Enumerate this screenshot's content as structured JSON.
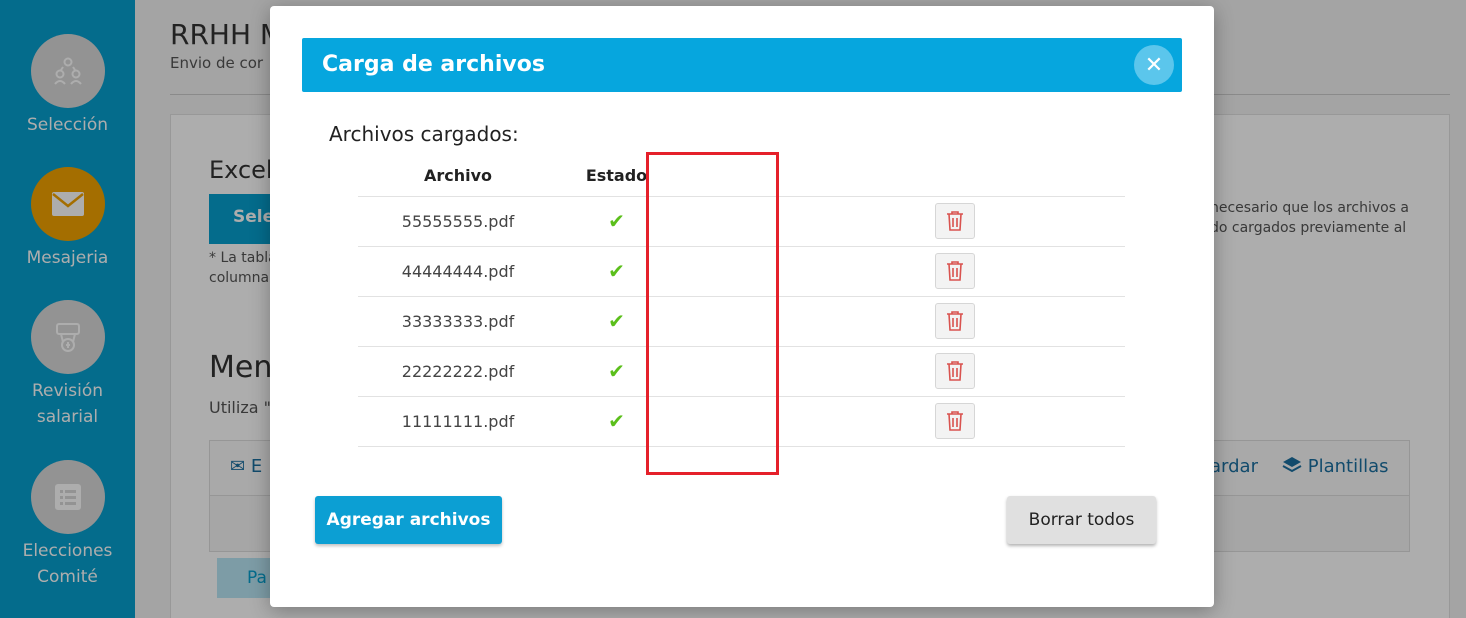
{
  "sidebar": {
    "items": [
      {
        "label": "Selección",
        "icon": "people-network-icon"
      },
      {
        "label": "Mesajeria",
        "icon": "envelope-icon"
      },
      {
        "label_line1": "Revisión",
        "label_line2": "salarial",
        "icon": "salary-review-icon"
      },
      {
        "label_line1": "Elecciones",
        "label_line2": "Comité",
        "icon": "ballot-list-icon"
      }
    ],
    "active_color": "#f2a200",
    "bg_color": "#06a0cf"
  },
  "background": {
    "title": "RRHH M",
    "subtitle": "Envio de cor",
    "excel_heading": "Excel",
    "select_button": "Sele",
    "note_line1": "* La tabla",
    "note_line2": "columna",
    "right_note_line1": "necesario que los archivos a",
    "right_note_line2": "do cargados previamente al",
    "men_heading": "Men",
    "utiliza_text": "Utiliza \"",
    "toolbar_e": "E",
    "toolbar_guardar": "ardar",
    "toolbar_plantillas": "Plantillas",
    "pa_button": "Pa"
  },
  "modal": {
    "title": "Carga de archivos",
    "section_title": "Archivos cargados:",
    "columns": {
      "file": "Archivo",
      "state": "Estado"
    },
    "files": [
      {
        "name": "55555555.pdf",
        "status": "ok"
      },
      {
        "name": "44444444.pdf",
        "status": "ok"
      },
      {
        "name": "33333333.pdf",
        "status": "ok"
      },
      {
        "name": "22222222.pdf",
        "status": "ok"
      },
      {
        "name": "11111111.pdf",
        "status": "ok"
      }
    ],
    "add_button": "Agregar archivos",
    "clear_button": "Borrar todos",
    "header_color": "#06a6de",
    "check_color": "#5bbf1b",
    "highlight_color": "#e5202a"
  }
}
